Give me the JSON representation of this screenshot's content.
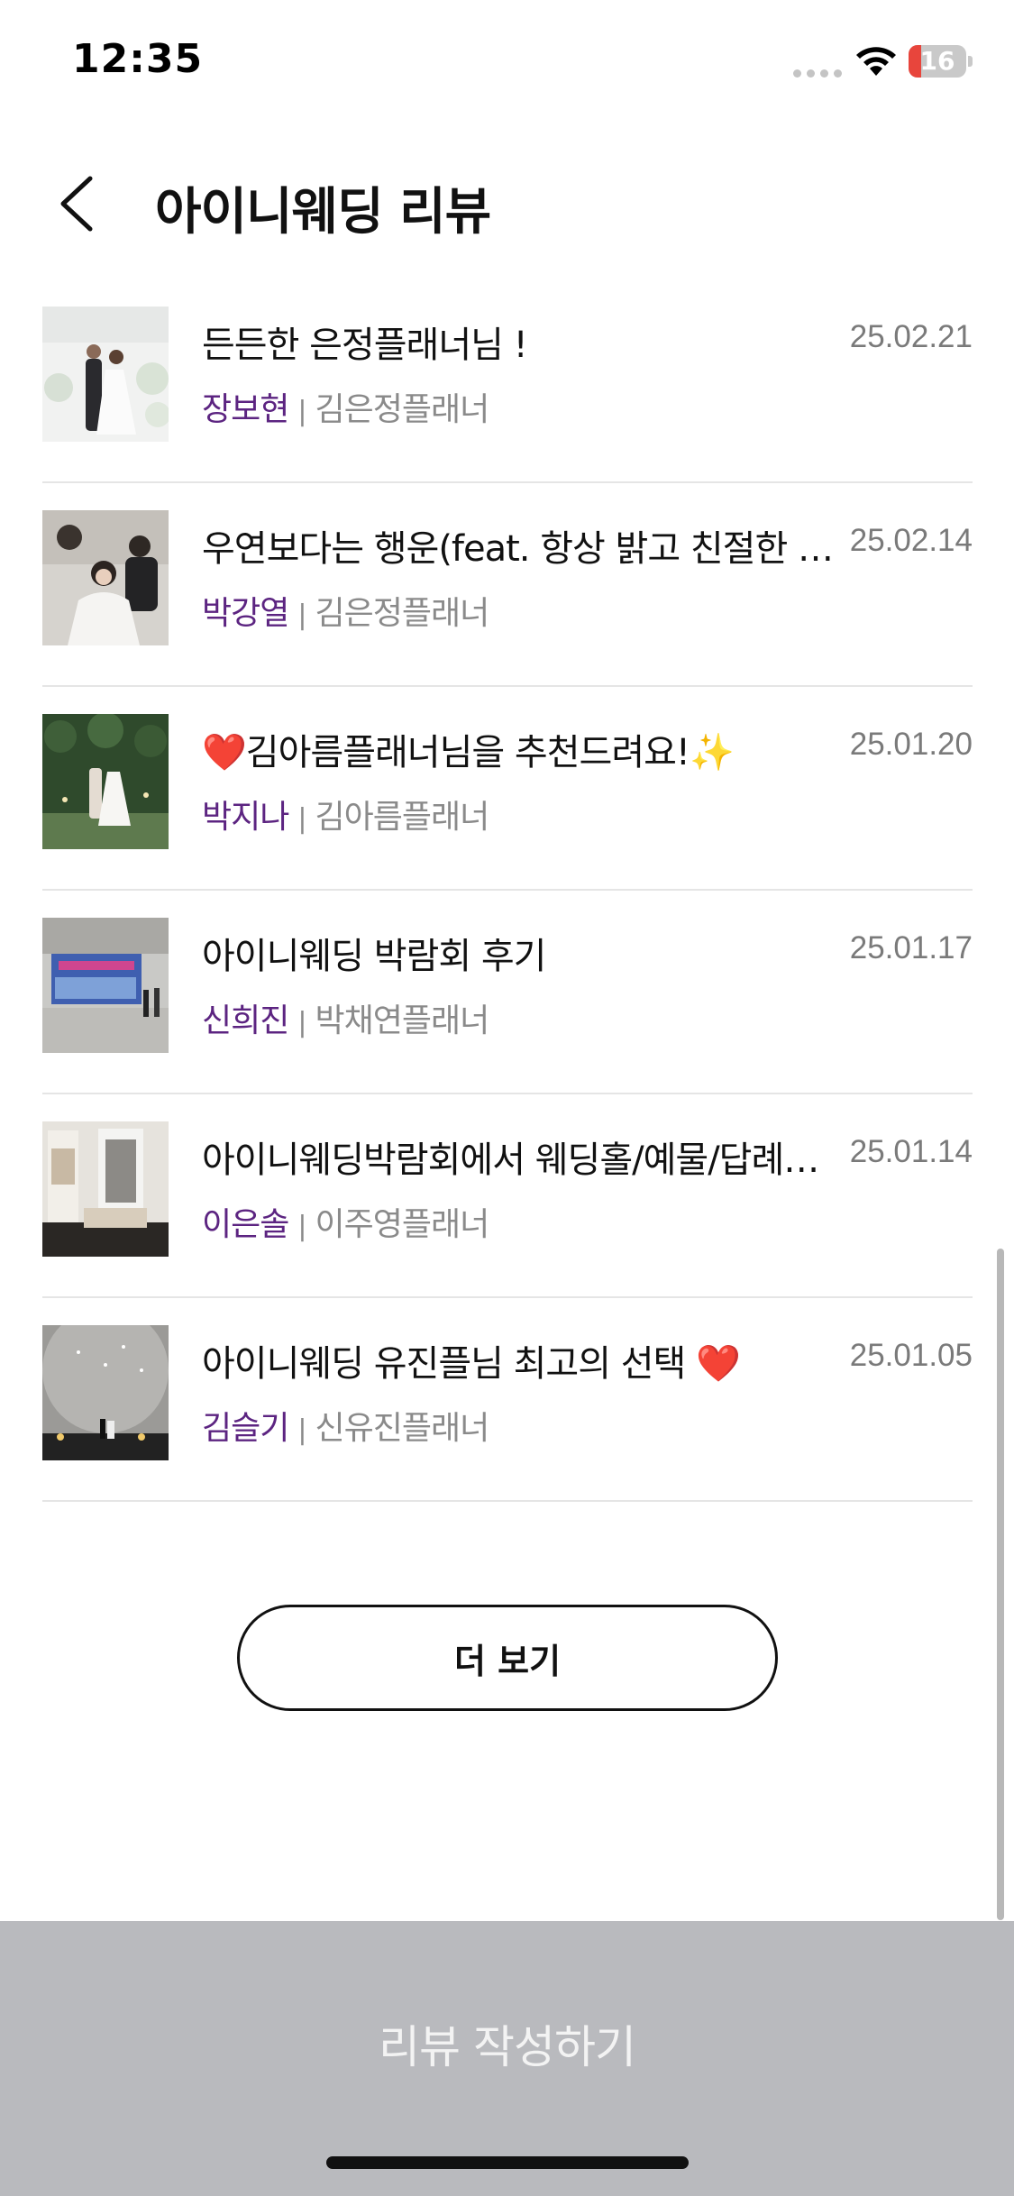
{
  "status_bar": {
    "time": "12:35",
    "battery": "16"
  },
  "header": {
    "title": "아이니웨딩 리뷰"
  },
  "reviews": [
    {
      "title": "든든한 은정플래너님 !",
      "author": "장보현",
      "separator": "|",
      "planner": "김은정플래너",
      "date": "25.02.21"
    },
    {
      "title": "우연보다는 행운(feat. 항상 밝고 친절한 은정플래너님)",
      "author": "박강열",
      "separator": "|",
      "planner": "김은정플래너",
      "date": "25.02.14"
    },
    {
      "title": "❤️김아름플래너님을 추천드려요!✨",
      "author": "박지나",
      "separator": "|",
      "planner": "김아름플래너",
      "date": "25.01.20"
    },
    {
      "title": "아이니웨딩 박람회 후기",
      "author": "신희진",
      "separator": "|",
      "planner": "박채연플래너",
      "date": "25.01.17"
    },
    {
      "title": "아이니웨딩박람회에서 웨딩홀/예물/답례품까지",
      "author": "이은솔",
      "separator": "|",
      "planner": "이주영플래너",
      "date": "25.01.14"
    },
    {
      "title": "아이니웨딩 유진플님 최고의 선택 ❤️",
      "author": "김슬기",
      "separator": "|",
      "planner": "신유진플래너",
      "date": "25.01.05"
    }
  ],
  "more_button": {
    "label": "더 보기"
  },
  "write_button": {
    "label": "리뷰 작성하기"
  },
  "colors": {
    "author": "#5c2481",
    "date": "#7a7a7a",
    "divider": "#e5e5e5",
    "write_bg": "#b9babe"
  },
  "icons": {
    "back": "chevron-left-icon",
    "wifi": "wifi-icon",
    "battery": "battery-icon"
  }
}
